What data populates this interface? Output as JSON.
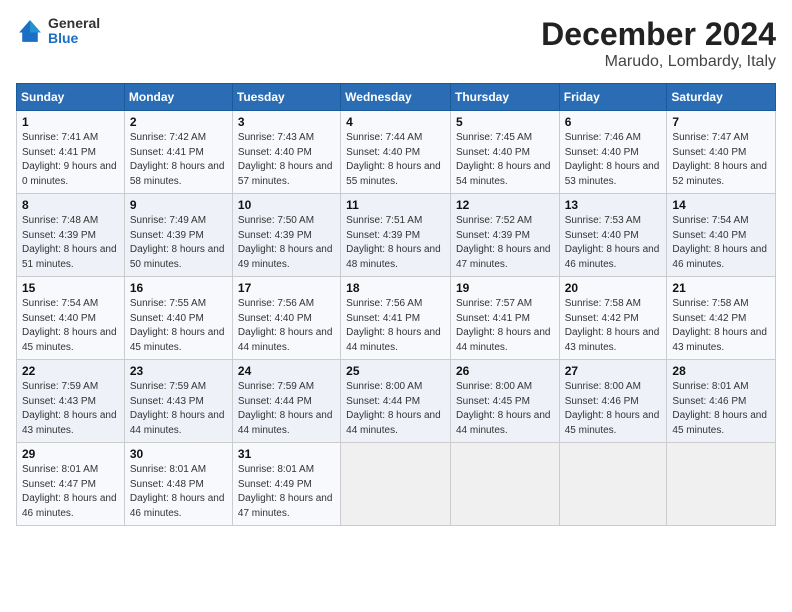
{
  "header": {
    "logo_line1": "General",
    "logo_line2": "Blue",
    "title": "December 2024",
    "subtitle": "Marudo, Lombardy, Italy"
  },
  "weekdays": [
    "Sunday",
    "Monday",
    "Tuesday",
    "Wednesday",
    "Thursday",
    "Friday",
    "Saturday"
  ],
  "weeks": [
    [
      {
        "day": "1",
        "sunrise": "Sunrise: 7:41 AM",
        "sunset": "Sunset: 4:41 PM",
        "daylight": "Daylight: 9 hours and 0 minutes."
      },
      {
        "day": "2",
        "sunrise": "Sunrise: 7:42 AM",
        "sunset": "Sunset: 4:41 PM",
        "daylight": "Daylight: 8 hours and 58 minutes."
      },
      {
        "day": "3",
        "sunrise": "Sunrise: 7:43 AM",
        "sunset": "Sunset: 4:40 PM",
        "daylight": "Daylight: 8 hours and 57 minutes."
      },
      {
        "day": "4",
        "sunrise": "Sunrise: 7:44 AM",
        "sunset": "Sunset: 4:40 PM",
        "daylight": "Daylight: 8 hours and 55 minutes."
      },
      {
        "day": "5",
        "sunrise": "Sunrise: 7:45 AM",
        "sunset": "Sunset: 4:40 PM",
        "daylight": "Daylight: 8 hours and 54 minutes."
      },
      {
        "day": "6",
        "sunrise": "Sunrise: 7:46 AM",
        "sunset": "Sunset: 4:40 PM",
        "daylight": "Daylight: 8 hours and 53 minutes."
      },
      {
        "day": "7",
        "sunrise": "Sunrise: 7:47 AM",
        "sunset": "Sunset: 4:40 PM",
        "daylight": "Daylight: 8 hours and 52 minutes."
      }
    ],
    [
      {
        "day": "8",
        "sunrise": "Sunrise: 7:48 AM",
        "sunset": "Sunset: 4:39 PM",
        "daylight": "Daylight: 8 hours and 51 minutes."
      },
      {
        "day": "9",
        "sunrise": "Sunrise: 7:49 AM",
        "sunset": "Sunset: 4:39 PM",
        "daylight": "Daylight: 8 hours and 50 minutes."
      },
      {
        "day": "10",
        "sunrise": "Sunrise: 7:50 AM",
        "sunset": "Sunset: 4:39 PM",
        "daylight": "Daylight: 8 hours and 49 minutes."
      },
      {
        "day": "11",
        "sunrise": "Sunrise: 7:51 AM",
        "sunset": "Sunset: 4:39 PM",
        "daylight": "Daylight: 8 hours and 48 minutes."
      },
      {
        "day": "12",
        "sunrise": "Sunrise: 7:52 AM",
        "sunset": "Sunset: 4:39 PM",
        "daylight": "Daylight: 8 hours and 47 minutes."
      },
      {
        "day": "13",
        "sunrise": "Sunrise: 7:53 AM",
        "sunset": "Sunset: 4:40 PM",
        "daylight": "Daylight: 8 hours and 46 minutes."
      },
      {
        "day": "14",
        "sunrise": "Sunrise: 7:54 AM",
        "sunset": "Sunset: 4:40 PM",
        "daylight": "Daylight: 8 hours and 46 minutes."
      }
    ],
    [
      {
        "day": "15",
        "sunrise": "Sunrise: 7:54 AM",
        "sunset": "Sunset: 4:40 PM",
        "daylight": "Daylight: 8 hours and 45 minutes."
      },
      {
        "day": "16",
        "sunrise": "Sunrise: 7:55 AM",
        "sunset": "Sunset: 4:40 PM",
        "daylight": "Daylight: 8 hours and 45 minutes."
      },
      {
        "day": "17",
        "sunrise": "Sunrise: 7:56 AM",
        "sunset": "Sunset: 4:40 PM",
        "daylight": "Daylight: 8 hours and 44 minutes."
      },
      {
        "day": "18",
        "sunrise": "Sunrise: 7:56 AM",
        "sunset": "Sunset: 4:41 PM",
        "daylight": "Daylight: 8 hours and 44 minutes."
      },
      {
        "day": "19",
        "sunrise": "Sunrise: 7:57 AM",
        "sunset": "Sunset: 4:41 PM",
        "daylight": "Daylight: 8 hours and 44 minutes."
      },
      {
        "day": "20",
        "sunrise": "Sunrise: 7:58 AM",
        "sunset": "Sunset: 4:42 PM",
        "daylight": "Daylight: 8 hours and 43 minutes."
      },
      {
        "day": "21",
        "sunrise": "Sunrise: 7:58 AM",
        "sunset": "Sunset: 4:42 PM",
        "daylight": "Daylight: 8 hours and 43 minutes."
      }
    ],
    [
      {
        "day": "22",
        "sunrise": "Sunrise: 7:59 AM",
        "sunset": "Sunset: 4:43 PM",
        "daylight": "Daylight: 8 hours and 43 minutes."
      },
      {
        "day": "23",
        "sunrise": "Sunrise: 7:59 AM",
        "sunset": "Sunset: 4:43 PM",
        "daylight": "Daylight: 8 hours and 44 minutes."
      },
      {
        "day": "24",
        "sunrise": "Sunrise: 7:59 AM",
        "sunset": "Sunset: 4:44 PM",
        "daylight": "Daylight: 8 hours and 44 minutes."
      },
      {
        "day": "25",
        "sunrise": "Sunrise: 8:00 AM",
        "sunset": "Sunset: 4:44 PM",
        "daylight": "Daylight: 8 hours and 44 minutes."
      },
      {
        "day": "26",
        "sunrise": "Sunrise: 8:00 AM",
        "sunset": "Sunset: 4:45 PM",
        "daylight": "Daylight: 8 hours and 44 minutes."
      },
      {
        "day": "27",
        "sunrise": "Sunrise: 8:00 AM",
        "sunset": "Sunset: 4:46 PM",
        "daylight": "Daylight: 8 hours and 45 minutes."
      },
      {
        "day": "28",
        "sunrise": "Sunrise: 8:01 AM",
        "sunset": "Sunset: 4:46 PM",
        "daylight": "Daylight: 8 hours and 45 minutes."
      }
    ],
    [
      {
        "day": "29",
        "sunrise": "Sunrise: 8:01 AM",
        "sunset": "Sunset: 4:47 PM",
        "daylight": "Daylight: 8 hours and 46 minutes."
      },
      {
        "day": "30",
        "sunrise": "Sunrise: 8:01 AM",
        "sunset": "Sunset: 4:48 PM",
        "daylight": "Daylight: 8 hours and 46 minutes."
      },
      {
        "day": "31",
        "sunrise": "Sunrise: 8:01 AM",
        "sunset": "Sunset: 4:49 PM",
        "daylight": "Daylight: 8 hours and 47 minutes."
      },
      null,
      null,
      null,
      null
    ]
  ]
}
